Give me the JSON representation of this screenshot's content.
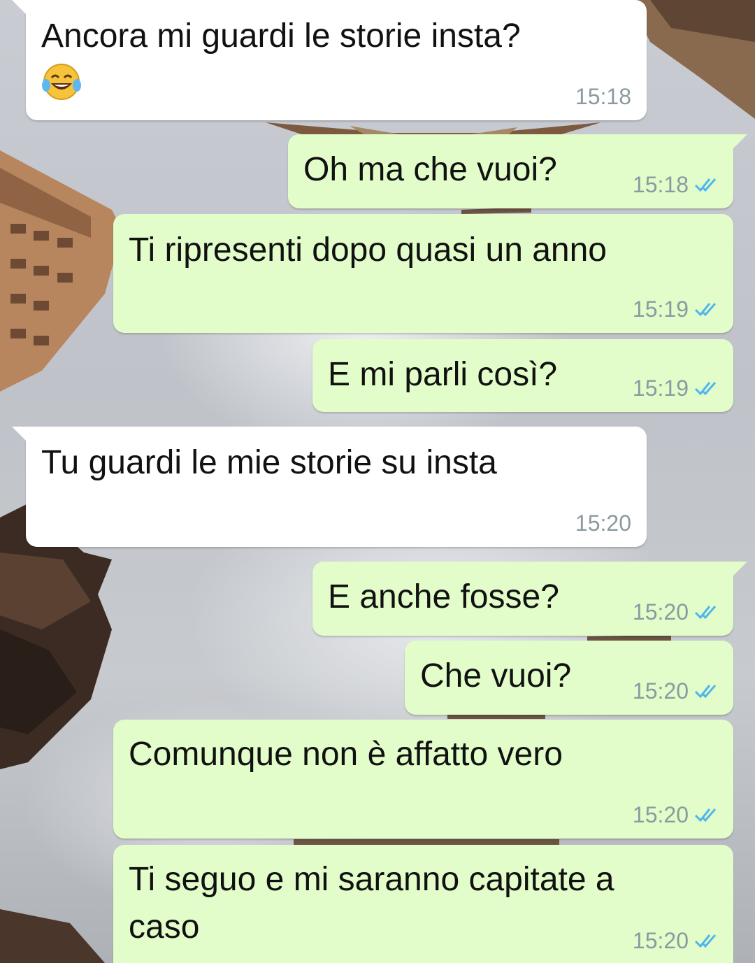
{
  "chat": {
    "outgoing_bubble_color": "#e2fdc9",
    "incoming_bubble_color": "#ffffff",
    "read_tick_color": "#4fb6ec",
    "messages": [
      {
        "direction": "incoming",
        "text": "Ancora mi guardi le storie insta?",
        "emoji": "face-with-tears-of-joy-icon",
        "time": "15:18"
      },
      {
        "direction": "outgoing",
        "text": "Oh ma che vuoi?",
        "time": "15:18",
        "status": "read"
      },
      {
        "direction": "outgoing",
        "text": "Ti ripresenti dopo quasi un anno",
        "time": "15:19",
        "status": "read"
      },
      {
        "direction": "outgoing",
        "text": "E mi parli così?",
        "time": "15:19",
        "status": "read"
      },
      {
        "direction": "incoming",
        "text": "Tu guardi le mie storie su insta",
        "time": "15:20"
      },
      {
        "direction": "outgoing",
        "text": "E anche fosse?",
        "time": "15:20",
        "status": "read"
      },
      {
        "direction": "outgoing",
        "text": "Che vuoi?",
        "time": "15:20",
        "status": "read"
      },
      {
        "direction": "outgoing",
        "text": "Comunque non è affatto vero",
        "time": "15:20",
        "status": "read"
      },
      {
        "direction": "outgoing",
        "text": "Ti seguo e mi saranno capitate a\ncaso",
        "time": "15:20",
        "status": "read"
      }
    ]
  }
}
